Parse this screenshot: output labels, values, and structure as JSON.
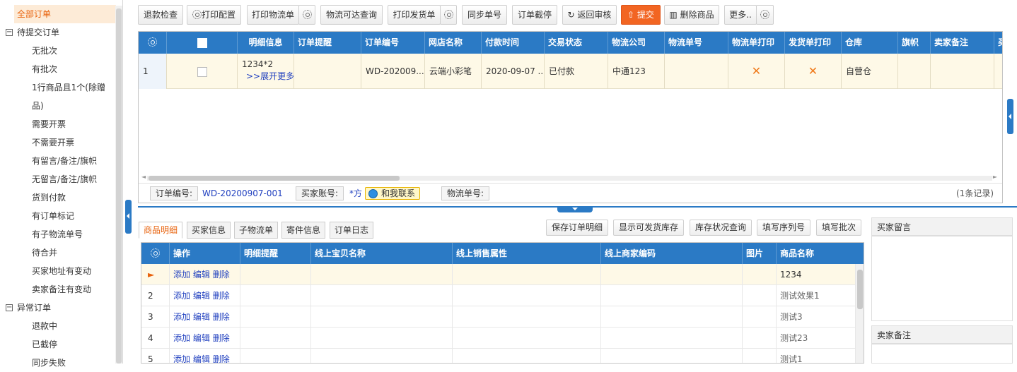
{
  "sidebar": {
    "selected": "全部订单",
    "groups": [
      {
        "label": "待提交订单",
        "toggle": "−",
        "items": [
          "无批次",
          "有批次",
          "1行商品且1个(除赠",
          "品)",
          "需要开票",
          "不需要开票",
          "有留言/备注/旗帜",
          "无留言/备注/旗帜",
          "货到付款",
          "有订单标记",
          "有子物流单号",
          "待合并",
          "买家地址有变动",
          "卖家备注有变动"
        ]
      },
      {
        "label": "异常订单",
        "toggle": "−",
        "items": [
          "退款中",
          "已截停",
          "同步失败"
        ]
      }
    ]
  },
  "toolbar": {
    "refund_check": "退款检查",
    "print_config": "打印配置",
    "print_logistics": "打印物流单",
    "logistics_query": "物流可达查询",
    "print_invoice": "打印发货单",
    "sync_no": "同步单号",
    "intercept": "订单截停",
    "return_review": "返回审核",
    "submit": "提交",
    "delete_goods": "删除商品",
    "more": "更多.."
  },
  "grid1": {
    "columns": [
      "明细信息",
      "订单提醒",
      "订单编号",
      "网店名称",
      "付款时间",
      "交易状态",
      "物流公司",
      "物流单号",
      "物流单打印",
      "发货单打印",
      "仓库",
      "旗帜",
      "卖家备注",
      "买"
    ],
    "row": {
      "index": "1",
      "detail": "1234*2",
      "expand": ">>展开更多",
      "order_no": "WD-202009...",
      "shop": "云端小彩笔",
      "pay_time": "2020-09-07 ...",
      "status": "已付款",
      "logistics": "中通123",
      "logistics_print": "✕",
      "invoice_print": "✕",
      "warehouse": "自营仓"
    }
  },
  "infobar": {
    "order_no_label": "订单编号:",
    "order_no_value": "WD-20200907-001",
    "buyer_label": "买家账号:",
    "buyer_value": "*方",
    "contact": "和我联系",
    "logistics_label": "物流单号:",
    "records": "(1条记录)"
  },
  "bottom_tabs": [
    "商品明细",
    "买家信息",
    "子物流单",
    "寄件信息",
    "订单日志"
  ],
  "bottom_buttons": [
    "保存订单明细",
    "显示可发货库存",
    "库存状况查询",
    "填写序列号",
    "填写批次"
  ],
  "grid2": {
    "columns": [
      "操作",
      "明细提醒",
      "线上宝贝名称",
      "线上销售属性",
      "线上商家编码",
      "图片",
      "商品名称"
    ],
    "actions": [
      "添加",
      "编辑",
      "删除"
    ],
    "rows": [
      {
        "idx": "►",
        "name": "1234"
      },
      {
        "idx": "2",
        "name": "测试效果1"
      },
      {
        "idx": "3",
        "name": "测试3"
      },
      {
        "idx": "4",
        "name": "测试23"
      },
      {
        "idx": "5",
        "name": "测试1"
      }
    ]
  },
  "panels": {
    "buyer_msg": "买家留言",
    "seller_note": "卖家备注"
  },
  "colors": {
    "accent": "#2b7ac5",
    "orange": "#f26522",
    "highlight": "#fef9e7"
  }
}
